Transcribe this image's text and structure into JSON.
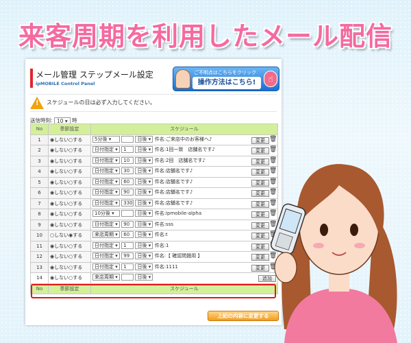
{
  "banner": "来客周期を利用したメール配信",
  "header": {
    "title": "メール管理  ステップメール設定",
    "subtitle": "ipMOBILE Control Panel"
  },
  "help": {
    "question": "ご不明点はこちらをクリック",
    "main": "操作方法はこちら!",
    "hand_icon": "pointing-hand-icon"
  },
  "warning": {
    "text": "スケジュールの日は必ず入力してください。",
    "icon": "warning-triangle-icon"
  },
  "send_time": {
    "label": "送信時刻:",
    "value": "10",
    "unit": "時"
  },
  "table": {
    "headers": {
      "no": "No",
      "season": "季節設定",
      "schedule": "スケジュール"
    },
    "radio_off": "しない",
    "radio_on": "する",
    "rows": [
      {
        "no": "1",
        "type": "5分後",
        "num": "",
        "unit": "日後",
        "subject": "件名:ご来店中のお客様へ♪",
        "action": "変更",
        "trash": true,
        "selected_off": true
      },
      {
        "no": "2",
        "type": "日付指定",
        "num": "1",
        "unit": "日後",
        "subject": "件名:1回一致　店舗名です♪",
        "action": "変更",
        "trash": true,
        "selected_off": true
      },
      {
        "no": "3",
        "type": "日付指定",
        "num": "10",
        "unit": "日後",
        "subject": "件名:2回　店舗名です♪",
        "action": "変更",
        "trash": true,
        "selected_off": true
      },
      {
        "no": "4",
        "type": "日付指定",
        "num": "30",
        "unit": "日後",
        "subject": "件名:店舗名です♪",
        "action": "変更",
        "trash": true,
        "selected_off": true
      },
      {
        "no": "5",
        "type": "日付指定",
        "num": "60",
        "unit": "日後",
        "subject": "件名:店舗名です♪",
        "action": "変更",
        "trash": true,
        "selected_off": true
      },
      {
        "no": "6",
        "type": "日付指定",
        "num": "90",
        "unit": "日後",
        "subject": "件名:店舗名です♪",
        "action": "変更",
        "trash": true,
        "selected_off": true
      },
      {
        "no": "7",
        "type": "日付指定",
        "num": "330",
        "unit": "日後",
        "subject": "件名:店舗名です♪",
        "action": "変更",
        "trash": true,
        "selected_off": true
      },
      {
        "no": "8",
        "type": "10分後",
        "num": "",
        "unit": "日後",
        "subject": "件名:ipmobile-alpha",
        "action": "変更",
        "trash": true,
        "selected_off": true
      },
      {
        "no": "9",
        "type": "日付指定",
        "num": "90",
        "unit": "日後",
        "subject": "件名:sss",
        "action": "変更",
        "trash": true,
        "selected_off": true
      },
      {
        "no": "10",
        "type": "来店周期",
        "num": "60",
        "unit": "日後",
        "subject": "件名:t",
        "action": "変更",
        "trash": true,
        "selected_off": false
      },
      {
        "no": "11",
        "type": "日付指定",
        "num": "1",
        "unit": "日後",
        "subject": "件名:1",
        "action": "変更",
        "trash": true,
        "selected_off": true
      },
      {
        "no": "12",
        "type": "日付指定",
        "num": "99",
        "unit": "日後",
        "subject": "件名:【 確認問題用 】",
        "action": "変更",
        "trash": true,
        "selected_off": true
      },
      {
        "no": "13",
        "type": "日付指定",
        "num": "1",
        "unit": "日後",
        "subject": "件名:1111",
        "action": "変更",
        "trash": true,
        "selected_off": true
      },
      {
        "no": "14",
        "type": "来店周期",
        "num": "",
        "unit": "日後",
        "subject": "",
        "action": "追加",
        "trash": false,
        "selected_off": true
      }
    ]
  },
  "save_button": "上記の内容に変更する",
  "illustration": {
    "person": "woman-holding-phone",
    "colors": {
      "hair": "#a8592f",
      "shirt": "#f27a9e",
      "skin": "#fbdcc8"
    }
  },
  "colors": {
    "banner": "#f46aa0",
    "header_bar": "#e0262f",
    "table_header": "#d3ef9a",
    "highlight": "#e01818",
    "save": "#f39d1c"
  }
}
